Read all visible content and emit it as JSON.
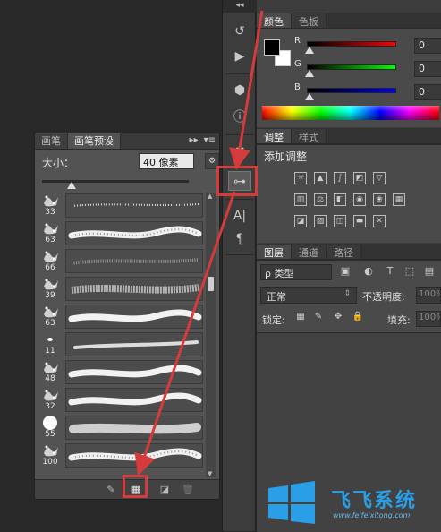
{
  "brush_panel": {
    "tabs": [
      {
        "label": "画笔"
      },
      {
        "label": "画笔预设"
      }
    ],
    "active_tab": 1,
    "size_label": "大小：",
    "size_value": "40 像素",
    "size_fraction": 0.2,
    "brushes": [
      {
        "size": "33",
        "style": "dotted"
      },
      {
        "size": "63",
        "style": "chalk"
      },
      {
        "size": "66",
        "style": "soft-dots"
      },
      {
        "size": "39",
        "style": "textured"
      },
      {
        "size": "63",
        "style": "brush"
      },
      {
        "size": "11",
        "style": "thin"
      },
      {
        "size": "48",
        "style": "brush"
      },
      {
        "size": "32",
        "style": "brush"
      },
      {
        "size": "55",
        "style": "round"
      },
      {
        "size": "100",
        "style": "chalk"
      }
    ],
    "footer_icons": [
      "toggle-brush-panel-icon",
      "create-preset-icon",
      "new-brush-icon",
      "trash-icon"
    ]
  },
  "dock": {
    "collapse_label": "◂◂",
    "buttons": [
      "history-icon",
      "play-actions-icon",
      "cube-3d-icon",
      "info-icon",
      "brush-tool-icon",
      "adjustments-icon",
      "character-icon",
      "paragraph-icon"
    ]
  },
  "color_panel": {
    "tabs": [
      {
        "label": "颜色"
      },
      {
        "label": "色板"
      }
    ],
    "channels": [
      {
        "label": "R",
        "value": "0",
        "gradient": "linear-gradient(to right,#000,#ff0000)"
      },
      {
        "label": "G",
        "value": "0",
        "gradient": "linear-gradient(to right,#000,#00ff00)"
      },
      {
        "label": "B",
        "value": "0",
        "gradient": "linear-gradient(to right,#000,#0000ff)"
      }
    ],
    "foreground": "#000000",
    "background": "#ffffff"
  },
  "adjust_panel": {
    "tabs": [
      {
        "label": "调整"
      },
      {
        "label": "样式"
      }
    ],
    "title": "添加调整"
  },
  "layers_panel": {
    "tabs": [
      {
        "label": "图层"
      },
      {
        "label": "通道"
      },
      {
        "label": "路径"
      }
    ],
    "kind_label": "ρ 类型",
    "blend_mode": "正常",
    "opacity_label": "不透明度:",
    "opacity_value": "100%",
    "lock_label": "锁定:",
    "fill_label": "填充:",
    "fill_value": "100%"
  },
  "watermark": {
    "text": "飞飞系统",
    "url": "www.feifeixitong.com"
  },
  "colors": {
    "highlight": "#d63b3b",
    "watermark_blue": "#2a9fe8"
  }
}
